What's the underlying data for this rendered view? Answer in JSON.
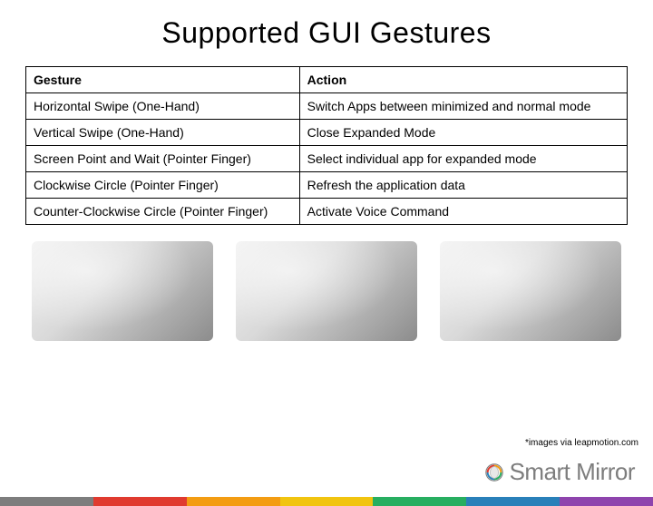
{
  "title": "Supported GUI Gestures",
  "table": {
    "headers": {
      "gesture": "Gesture",
      "action": "Action"
    },
    "rows": [
      {
        "gesture": "Horizontal Swipe (One-Hand)",
        "action": "Switch Apps between minimized and normal mode"
      },
      {
        "gesture": "Vertical Swipe (One-Hand)",
        "action": "Close Expanded Mode"
      },
      {
        "gesture": "Screen Point and Wait (Pointer Finger)",
        "action": "Select individual app for expanded mode"
      },
      {
        "gesture": "Clockwise Circle (Pointer Finger)",
        "action": "Refresh the application data"
      },
      {
        "gesture": "Counter-Clockwise Circle (Pointer Finger)",
        "action": "Activate Voice Command"
      }
    ]
  },
  "credit": "*images via leapmotion.com",
  "brand": "Smart Mirror",
  "rainbow_colors": [
    "#7d7d7d",
    "#e03a2f",
    "#f39c12",
    "#f1c40f",
    "#27ae60",
    "#2980b9",
    "#8e44ad"
  ]
}
